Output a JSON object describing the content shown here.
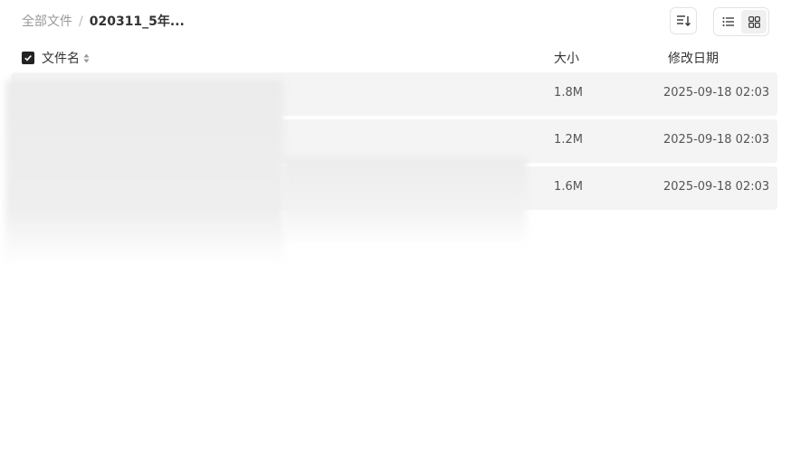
{
  "breadcrumb": {
    "root": "全部文件",
    "separator": "/",
    "current": "020311_5年..."
  },
  "toolbar": {
    "sort_icon": "sort-icon",
    "view_list_icon": "list-view-icon",
    "view_grid_icon": "grid-view-icon",
    "active_view": "list"
  },
  "table": {
    "headers": {
      "name": "文件名",
      "size": "大小",
      "modified": "修改日期"
    },
    "select_all_checked": true,
    "rows": [
      {
        "size": "1.8M",
        "modified": "2025-09-18 02:03"
      },
      {
        "size": "1.2M",
        "modified": "2025-09-18 02:03"
      },
      {
        "size": "1.6M",
        "modified": "2025-09-18 02:03"
      }
    ]
  },
  "colors": {
    "row_background": "#f4f4f4",
    "checkbox": "#222222",
    "text_primary": "#333333",
    "text_muted": "#999999"
  }
}
